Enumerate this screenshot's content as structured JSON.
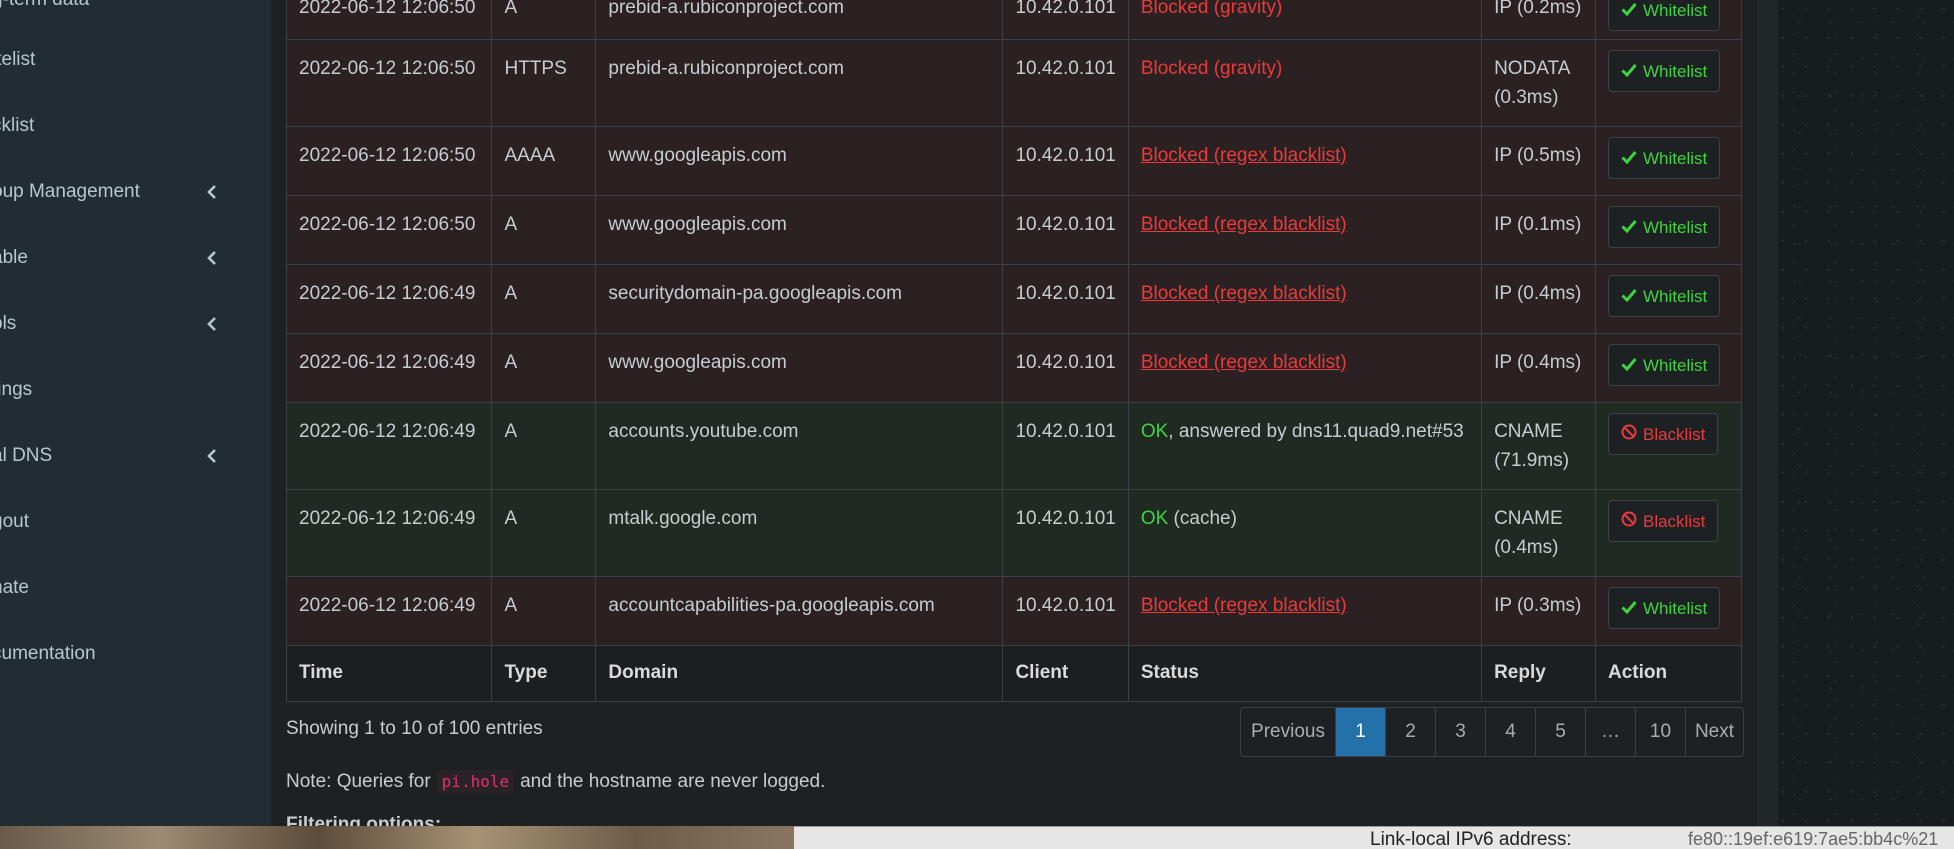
{
  "sidebar": {
    "items": [
      {
        "label": "g-term data",
        "chevron": false
      },
      {
        "label": "itelist",
        "chevron": false
      },
      {
        "label": "cklist",
        "chevron": false
      },
      {
        "label": "oup Management",
        "chevron": true
      },
      {
        "label": "able",
        "chevron": true
      },
      {
        "label": "ols",
        "chevron": true
      },
      {
        "label": "tings",
        "chevron": false
      },
      {
        "label": "al DNS",
        "chevron": true
      },
      {
        "label": "gout",
        "chevron": false
      },
      {
        "label": "nate",
        "chevron": false
      },
      {
        "label": "cumentation",
        "chevron": false
      }
    ]
  },
  "table": {
    "headers": {
      "time": "Time",
      "type": "Type",
      "domain": "Domain",
      "client": "Client",
      "status": "Status",
      "reply": "Reply",
      "action": "Action"
    },
    "rows": [
      {
        "time": "2022-06-12 12:06:50",
        "type": "A",
        "domain": "prebid-a.rubiconproject.com",
        "client": "10.42.0.101",
        "status_main": "Blocked (gravity)",
        "status_rest": "",
        "reply": "IP (0.2ms)",
        "action": "Whitelist"
      },
      {
        "time": "2022-06-12 12:06:50",
        "type": "HTTPS",
        "domain": "prebid-a.rubiconproject.com",
        "client": "10.42.0.101",
        "status_main": "Blocked (gravity)",
        "status_rest": "",
        "reply": "NODATA (0.3ms)",
        "action": "Whitelist"
      },
      {
        "time": "2022-06-12 12:06:50",
        "type": "AAAA",
        "domain": "www.googleapis.com",
        "client": "10.42.0.101",
        "status_main": "Blocked (regex blacklist)",
        "status_rest": "",
        "reply": "IP (0.5ms)",
        "action": "Whitelist"
      },
      {
        "time": "2022-06-12 12:06:50",
        "type": "A",
        "domain": "www.googleapis.com",
        "client": "10.42.0.101",
        "status_main": "Blocked (regex blacklist)",
        "status_rest": "",
        "reply": "IP (0.1ms)",
        "action": "Whitelist"
      },
      {
        "time": "2022-06-12 12:06:49",
        "type": "A",
        "domain": "securitydomain-pa.googleapis.com",
        "client": "10.42.0.101",
        "status_main": "Blocked (regex blacklist)",
        "status_rest": "",
        "reply": "IP (0.4ms)",
        "action": "Whitelist"
      },
      {
        "time": "2022-06-12 12:06:49",
        "type": "A",
        "domain": "www.googleapis.com",
        "client": "10.42.0.101",
        "status_main": "Blocked (regex blacklist)",
        "status_rest": "",
        "reply": "IP (0.4ms)",
        "action": "Whitelist"
      },
      {
        "time": "2022-06-12 12:06:49",
        "type": "A",
        "domain": "accounts.youtube.com",
        "client": "10.42.0.101",
        "status_main": "OK",
        "status_rest": ", answered by dns11.quad9.net#53",
        "reply": "CNAME (71.9ms)",
        "action": "Blacklist"
      },
      {
        "time": "2022-06-12 12:06:49",
        "type": "A",
        "domain": "mtalk.google.com",
        "client": "10.42.0.101",
        "status_main": "OK",
        "status_rest": " (cache)",
        "reply": "CNAME (0.4ms)",
        "action": "Blacklist"
      },
      {
        "time": "2022-06-12 12:06:49",
        "type": "A",
        "domain": "accountcapabilities-pa.googleapis.com",
        "client": "10.42.0.101",
        "status_main": "Blocked (regex blacklist)",
        "status_rest": "",
        "reply": "IP (0.3ms)",
        "action": "Whitelist"
      }
    ]
  },
  "footer": {
    "info": "Showing 1 to 10 of 100 entries",
    "pagination": [
      "Previous",
      "1",
      "2",
      "3",
      "4",
      "5",
      "…",
      "10",
      "Next"
    ],
    "active_page": "1",
    "note_prefix": "Note: Queries for",
    "note_code": "pi.hole",
    "note_suffix": "and the hostname are never logged.",
    "filtering_heading": "Filtering options:"
  },
  "bottom_strip": {
    "label": "Link-local IPv6 address:",
    "value": "fe80::19ef:e619:7ae5:bb4c%21"
  },
  "colors": {
    "blocked_row_bg": "#2b2022",
    "ok_row_bg": "#1e2a22",
    "blocked_text": "#ea3a3a",
    "ok_text": "#3fd33f",
    "active_page_bg": "#2470a8",
    "sidebar_bg": "#222d32"
  }
}
